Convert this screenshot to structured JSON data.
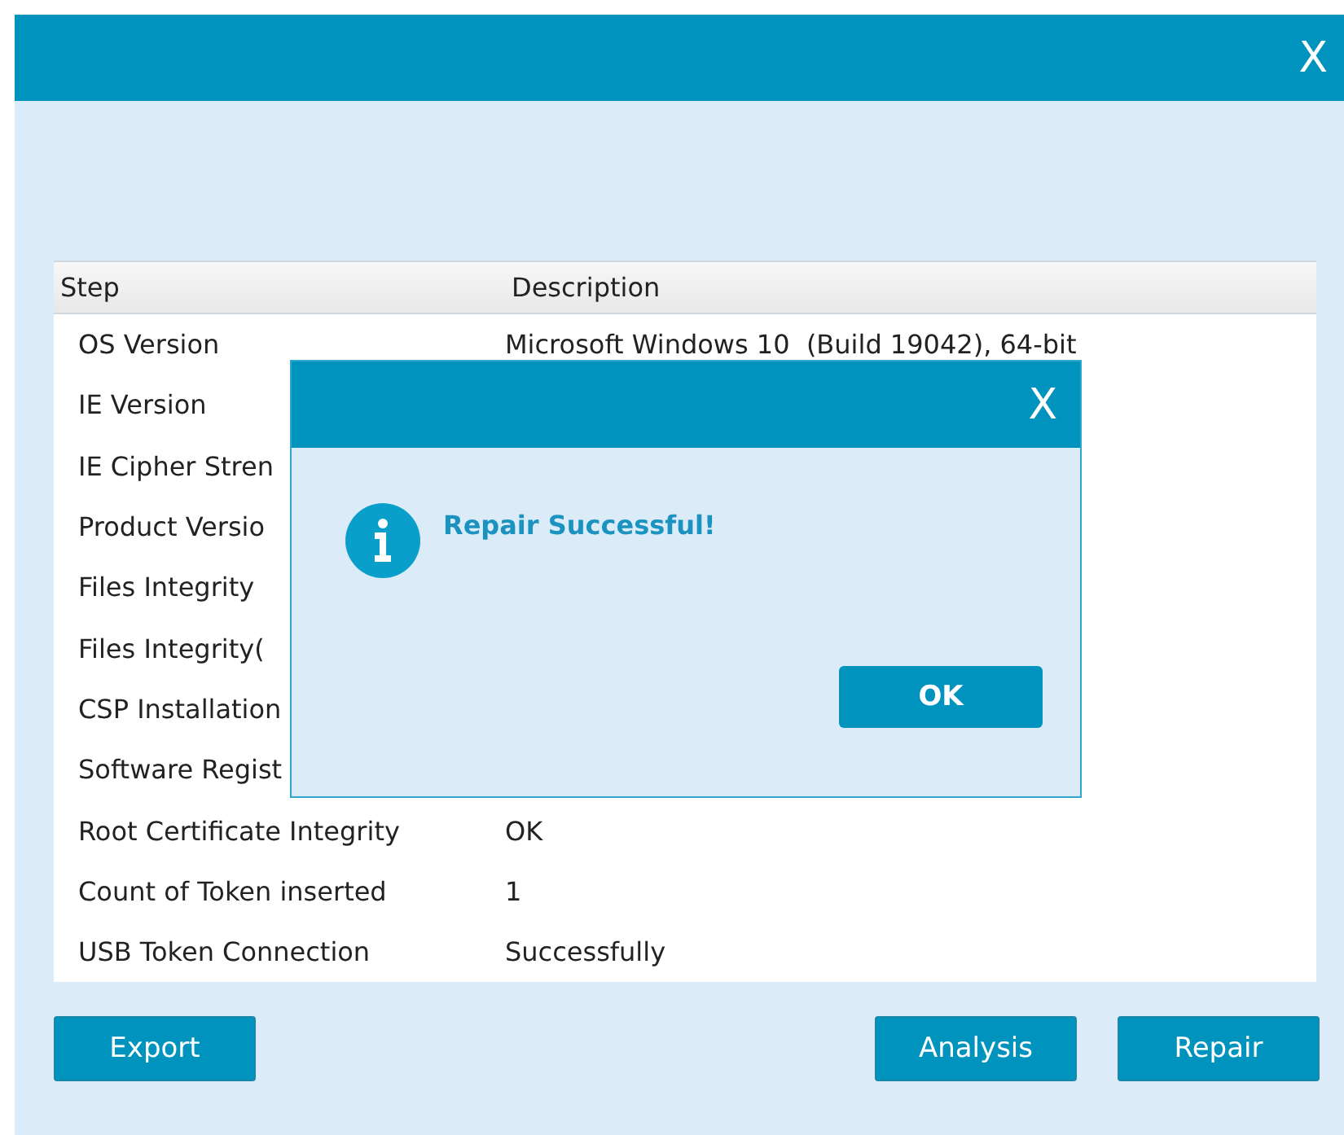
{
  "window": {
    "close": "X"
  },
  "table": {
    "columns": [
      "Step",
      "Description"
    ],
    "rows": [
      {
        "step": "OS Version",
        "description": "Microsoft Windows 10  (Build 19042), 64-bit"
      },
      {
        "step": "IE Version"
      },
      {
        "step": "IE Cipher Stren"
      },
      {
        "step": "Product Versio"
      },
      {
        "step": "Files Integrity"
      },
      {
        "step": "Files Integrity("
      },
      {
        "step": "CSP Installation"
      },
      {
        "step": "Software Regist"
      },
      {
        "step": "Root Certificate Integrity",
        "description": "OK"
      },
      {
        "step": "Count of Token inserted",
        "description": "1"
      },
      {
        "step": "USB Token Connection",
        "description": "Successfully"
      }
    ]
  },
  "buttons_left": [
    "Export"
  ],
  "buttons_right": [
    "Analysis",
    "Repair"
  ],
  "dialog": {
    "close": "X",
    "message": "Repair Successful!",
    "button": "OK"
  }
}
